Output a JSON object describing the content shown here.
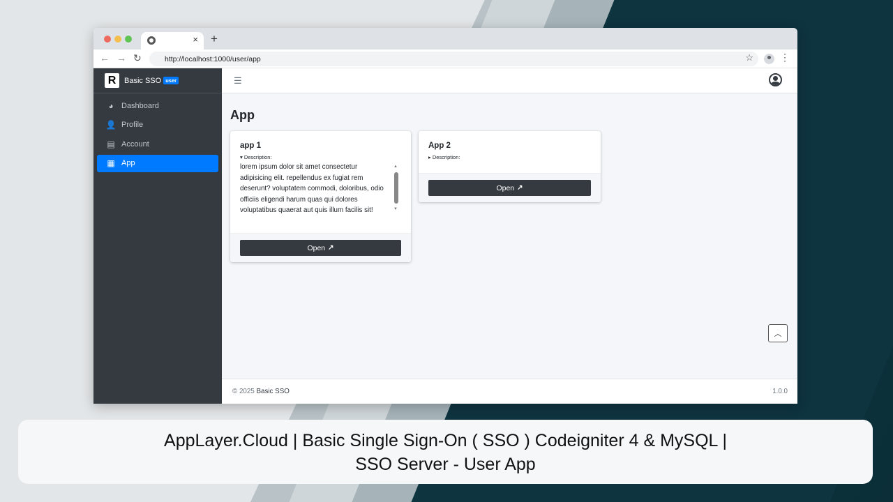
{
  "browser": {
    "url": "http://localhost:1000/user/app",
    "tab_close": "×",
    "new_tab": "+"
  },
  "sidebar": {
    "brand_logo": "R",
    "brand_name": "Basic SSO",
    "brand_badge": "user",
    "items": [
      {
        "label": "Dashboard",
        "icon": "tachometer-icon"
      },
      {
        "label": "Profile",
        "icon": "user-icon"
      },
      {
        "label": "Account",
        "icon": "id-card-icon"
      },
      {
        "label": "App",
        "icon": "grid-icon",
        "active": true
      }
    ]
  },
  "main": {
    "page_title": "App",
    "cards": [
      {
        "title": "app 1",
        "summary": "▾ Description:",
        "description": "lorem ipsum dolor sit amet consectetur adipisicing elit. repellendus ex fugiat rem deserunt? voluptatem commodi, doloribus, odio officiis eligendi harum quas qui dolores voluptatibus quaerat aut quis illum facilis sit!",
        "button": "Open"
      },
      {
        "title": "App 2",
        "summary": "▸ Description:",
        "button": "Open"
      }
    ]
  },
  "footer": {
    "copyright": "© 2025",
    "brand": "Basic SSO",
    "version": "1.0.0"
  },
  "caption": {
    "line1": "AppLayer.Cloud | Basic Single Sign-On ( SSO ) Codeigniter 4 & MySQL |",
    "line2": "SSO Server - User App"
  },
  "colors": {
    "sidebar_bg": "#343a40",
    "active": "#007bff",
    "content_bg": "#f4f6f9"
  }
}
